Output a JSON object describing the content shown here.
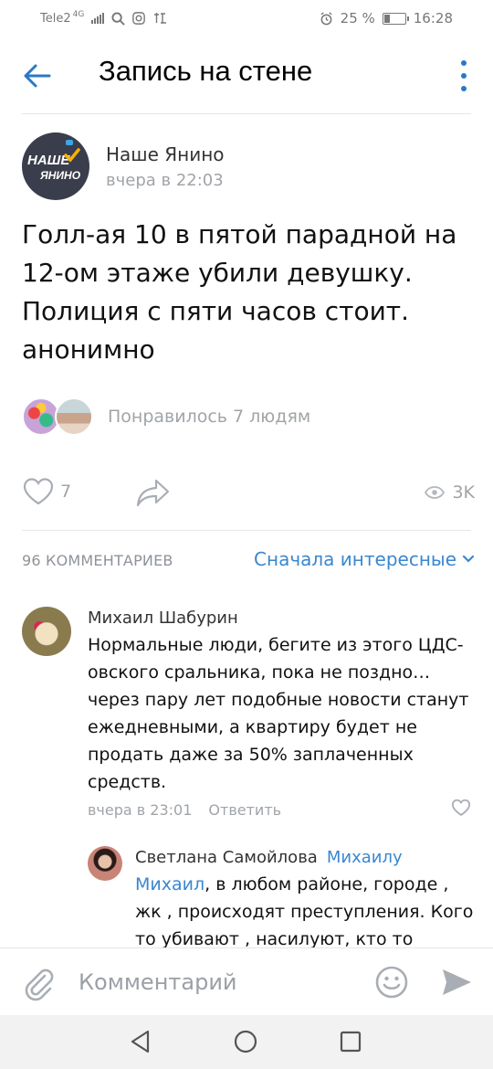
{
  "status_bar": {
    "carrier": "Tele2",
    "network": "4G",
    "battery": "25 %",
    "battery_level": 0.25,
    "time": "16:28"
  },
  "header": {
    "title": "Запись на стене"
  },
  "post": {
    "group_name": "Наше Янино",
    "avatar_text_1": "НАШЕ",
    "avatar_text_2": "ЯНИНО",
    "time": "вчера в 22:03",
    "text": "Голл-ая 10 в пятой парадной на 12-ом этаже убили девушку. Полиция с пяти часов стоит. анонимно",
    "likes_text": "Понравилось 7 людям",
    "like_count": "7",
    "views": "3K"
  },
  "comments_section": {
    "count_label": "96 КОММЕНТАРИЕВ",
    "sort_label": "Сначала интересные"
  },
  "comments": [
    {
      "author": "Михаил Шабурин",
      "text": "Нормальные люди, бегите из этого ЦДС-овского сральника, пока не поздно… через пару лет подобные новости станут ежедневными, а квартиру будет не продать даже за 50% заплаченных средств.",
      "time": "вчера в 23:01",
      "reply_label": "Ответить"
    },
    {
      "author": "Светлана Самойлова",
      "reply_to": "Михаилу",
      "mention": "Михаил",
      "text": ", в любом районе, городе , жк , происходят преступления. Кого то убивают , насилуют, кто то"
    }
  ],
  "input": {
    "placeholder": "Комментарий"
  },
  "colors": {
    "accent": "#2a78c8",
    "link": "#3a87d0",
    "muted": "#a0a4a8"
  }
}
